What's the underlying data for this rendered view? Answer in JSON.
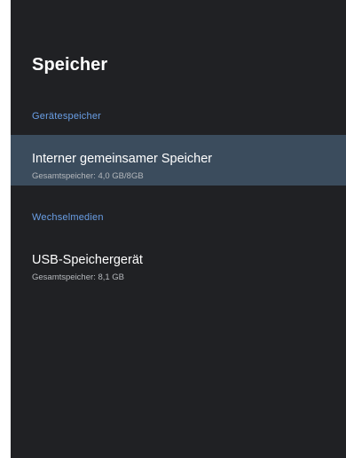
{
  "page": {
    "title": "Speicher"
  },
  "sections": [
    {
      "header": "Gerätespeicher",
      "items": [
        {
          "title": "Interner gemeinsamer Speicher",
          "subtitle": "Gesamtspeicher: 4,0 GB/8GB",
          "selected": true
        }
      ]
    },
    {
      "header": "Wechselmedien",
      "items": [
        {
          "title": "USB-Speichergerät",
          "subtitle": "Gesamtspeicher: 8,1 GB",
          "selected": false
        }
      ]
    }
  ],
  "colors": {
    "background": "#202124",
    "selected_row": "#3b4c5d",
    "section_header": "#6a9fe6",
    "primary_text": "#ffffff",
    "secondary_text": "#b5b8bc"
  }
}
